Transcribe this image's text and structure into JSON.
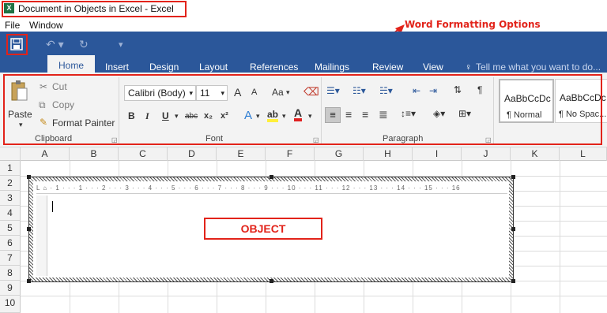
{
  "window": {
    "title": "Document in Objects in Excel - Excel",
    "app_icon": "excel-icon"
  },
  "menu": {
    "items": [
      "File",
      "Window"
    ]
  },
  "annotations": {
    "word_options": "Word Formatting Options",
    "object": "OBJECT"
  },
  "tabs": [
    "Home",
    "Insert",
    "Design",
    "Layout",
    "References",
    "Mailings",
    "Review",
    "View"
  ],
  "tell_me": "Tell me what you want to do...",
  "clipboard": {
    "paste": "Paste",
    "cut": "Cut",
    "copy": "Copy",
    "format_painter": "Format Painter",
    "label": "Clipboard"
  },
  "font": {
    "name": "Calibri (Body)",
    "size": "11",
    "label": "Font",
    "grow": "A",
    "shrink": "A",
    "case": "Aa",
    "bold": "B",
    "italic": "I",
    "underline": "U",
    "strike": "abc",
    "subscript": "x₂",
    "superscript": "x²"
  },
  "paragraph": {
    "label": "Paragraph",
    "pilcrow": "¶"
  },
  "styles": [
    {
      "preview": "AaBbCcDc",
      "name": "¶ Normal"
    },
    {
      "preview": "AaBbCcDc",
      "name": "¶ No Spac..."
    }
  ],
  "grid": {
    "columns": [
      "A",
      "B",
      "C",
      "D",
      "E",
      "F",
      "G",
      "H",
      "I",
      "J",
      "K",
      "L"
    ],
    "rows": [
      "1",
      "2",
      "3",
      "4",
      "5",
      "6",
      "7",
      "8",
      "9",
      "10"
    ]
  },
  "ruler": "L ⌂ · 1 · · · 1 · · · 2 · · · 3 · · · 4 · · · 5 · · · 6 · · · 7 · · · 8 · · · 9 · · · 10 · · · 11 · · · 12 · · · 13 · · · 14 · · · 15 · · · 16",
  "colors": {
    "word_blue": "#2b579a",
    "annotation_red": "#e2231a",
    "excel_green": "#1f7244"
  }
}
